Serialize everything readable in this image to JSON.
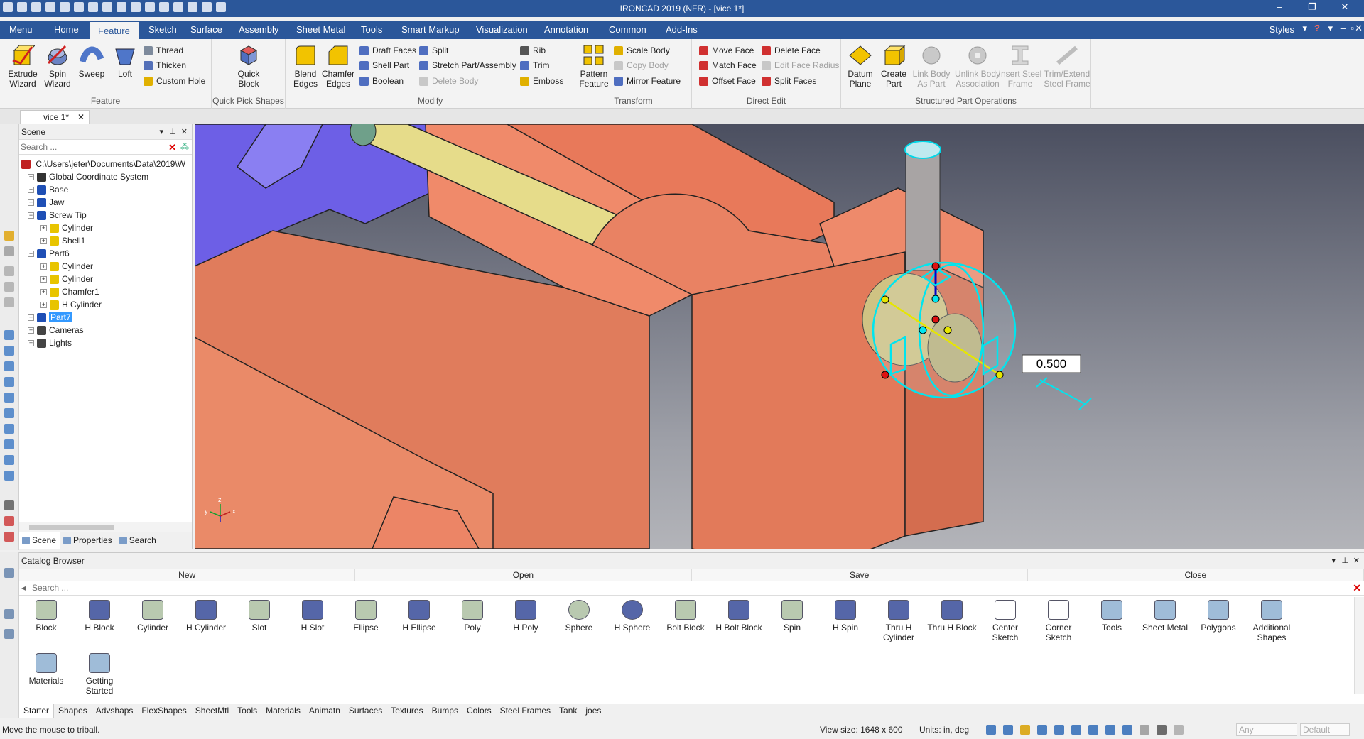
{
  "app": {
    "title": "IRONCAD 2019 (NFR) - [vice 1*]"
  },
  "window": {
    "minimize": "–",
    "restore": "❐",
    "close": "✕"
  },
  "menu": {
    "tabs": [
      "Menu",
      "Home",
      "Feature",
      "Sketch",
      "Surface",
      "Assembly",
      "Sheet Metal",
      "Tools",
      "Smart Markup",
      "Visualization",
      "Annotation",
      "Common",
      "Add-Ins"
    ],
    "active": "Feature",
    "styles": "Styles",
    "help": "?"
  },
  "ribbon": {
    "feature": {
      "label": "Feature",
      "extrude": "Extrude Wizard",
      "spin": "Spin Wizard",
      "sweep": "Sweep",
      "loft": "Loft",
      "thread": "Thread",
      "thicken": "Thicken",
      "custom_hole": "Custom Hole"
    },
    "quick": {
      "label": "Quick Pick Shapes",
      "quick_block": "Quick Block"
    },
    "modify": {
      "label": "Modify",
      "blend": "Blend Edges",
      "chamfer": "Chamfer Edges",
      "draft": "Draft Faces",
      "shell": "Shell Part",
      "boolean": "Boolean",
      "split": "Split",
      "stretch": "Stretch Part/Assembly",
      "delete_body": "Delete Body",
      "rib": "Rib",
      "trim": "Trim",
      "emboss": "Emboss"
    },
    "transform": {
      "label": "Transform",
      "pattern": "Pattern Feature",
      "scale": "Scale Body",
      "copy": "Copy Body",
      "mirror": "Mirror Feature"
    },
    "direct": {
      "label": "Direct Edit",
      "move": "Move Face",
      "match": "Match Face",
      "offset": "Offset Face",
      "delete_face": "Delete Face",
      "edit_radius": "Edit Face Radius",
      "split_faces": "Split Faces"
    },
    "structured": {
      "label": "Structured Part Operations",
      "datum": "Datum Plane",
      "create": "Create Part",
      "link": "Link Body As Part",
      "unlink": "Unlink Body Association",
      "insert_steel": "Insert Steel Frame",
      "trim_steel": "Trim/Extend Steel Frame"
    }
  },
  "doc_tab": {
    "name": "vice 1*",
    "close": "✕"
  },
  "scene": {
    "title": "Scene",
    "search_placeholder": "Search ...",
    "path": "C:\\Users\\jeter\\Documents\\Data\\2019\\W",
    "nodes": [
      {
        "label": "Global Coordinate System",
        "level": 1,
        "icon": "coordinate-icon",
        "color": "#333333"
      },
      {
        "label": "Base",
        "level": 1,
        "icon": "part-icon",
        "color": "#1f4fb5"
      },
      {
        "label": "Jaw",
        "level": 1,
        "icon": "part-icon",
        "color": "#1f4fb5"
      },
      {
        "label": "Screw Tip",
        "level": 1,
        "icon": "part-icon",
        "color": "#1f4fb5",
        "expanded": true
      },
      {
        "label": "Cylinder",
        "level": 2,
        "icon": "feature-icon",
        "color": "#e8c400"
      },
      {
        "label": "Shell1",
        "level": 2,
        "icon": "feature-icon",
        "color": "#e8c400"
      },
      {
        "label": "Part6",
        "level": 1,
        "icon": "part-icon",
        "color": "#1f4fb5",
        "expanded": true
      },
      {
        "label": "Cylinder",
        "level": 2,
        "icon": "feature-icon",
        "color": "#e8c400"
      },
      {
        "label": "Cylinder",
        "level": 2,
        "icon": "feature-icon",
        "color": "#e8c400"
      },
      {
        "label": "Chamfer1",
        "level": 2,
        "icon": "feature-icon",
        "color": "#e8c400"
      },
      {
        "label": "H Cylinder",
        "level": 2,
        "icon": "feature-icon",
        "color": "#e8c400"
      },
      {
        "label": "Part7",
        "level": 1,
        "icon": "part-icon",
        "color": "#1f4fb5",
        "selected": true
      },
      {
        "label": "Cameras",
        "level": 1,
        "icon": "camera-icon",
        "color": "#444444"
      },
      {
        "label": "Lights",
        "level": 1,
        "icon": "light-icon",
        "color": "#444444"
      }
    ],
    "tabs": [
      "Scene",
      "Properties",
      "Search"
    ]
  },
  "viewport": {
    "dimension_value": "0.500",
    "axes": {
      "x": "x",
      "y": "y",
      "z": "z"
    }
  },
  "catalog": {
    "title": "Catalog Browser",
    "actions": [
      "New",
      "Open",
      "Save",
      "Close"
    ],
    "search_placeholder": "Search ...",
    "items": [
      {
        "label": "Block",
        "icon": "block-icon"
      },
      {
        "label": "H Block",
        "icon": "h-block-icon"
      },
      {
        "label": "Cylinder",
        "icon": "cylinder-icon"
      },
      {
        "label": "H Cylinder",
        "icon": "h-cylinder-icon"
      },
      {
        "label": "Slot",
        "icon": "slot-icon"
      },
      {
        "label": "H Slot",
        "icon": "h-slot-icon"
      },
      {
        "label": "Ellipse",
        "icon": "ellipse-icon"
      },
      {
        "label": "H Ellipse",
        "icon": "h-ellipse-icon"
      },
      {
        "label": "Poly",
        "icon": "poly-icon"
      },
      {
        "label": "H Poly",
        "icon": "h-poly-icon"
      },
      {
        "label": "Sphere",
        "icon": "sphere-icon"
      },
      {
        "label": "H Sphere",
        "icon": "h-sphere-icon"
      },
      {
        "label": "Bolt Block",
        "icon": "bolt-block-icon"
      },
      {
        "label": "H Bolt Block",
        "icon": "h-bolt-block-icon"
      },
      {
        "label": "Spin",
        "icon": "spin-icon"
      },
      {
        "label": "H Spin",
        "icon": "h-spin-icon"
      },
      {
        "label": "Thru H Cylinder",
        "icon": "thru-h-cylinder-icon"
      },
      {
        "label": "Thru H Block",
        "icon": "thru-h-block-icon"
      },
      {
        "label": "Center Sketch",
        "icon": "center-sketch-icon"
      },
      {
        "label": "Corner Sketch",
        "icon": "corner-sketch-icon"
      },
      {
        "label": "Tools",
        "icon": "folder-icon"
      },
      {
        "label": "Sheet Metal",
        "icon": "folder-icon"
      },
      {
        "label": "Polygons",
        "icon": "folder-icon"
      },
      {
        "label": "Additional Shapes",
        "icon": "folder-icon"
      },
      {
        "label": "Materials",
        "icon": "folder-icon"
      },
      {
        "label": "Getting Started",
        "icon": "folder-icon"
      }
    ],
    "tabs": [
      "Starter",
      "Shapes",
      "Advshaps",
      "FlexShapes",
      "SheetMtl",
      "Tools",
      "Materials",
      "Animatn",
      "Surfaces",
      "Textures",
      "Bumps",
      "Colors",
      "Steel Frames",
      "Tank",
      "joes"
    ]
  },
  "status": {
    "message": "Move the mouse to triball.",
    "view_size": "View size: 1648 x 600",
    "units": "Units: in, deg",
    "dropdown1": "Any",
    "dropdown2": "Default"
  }
}
